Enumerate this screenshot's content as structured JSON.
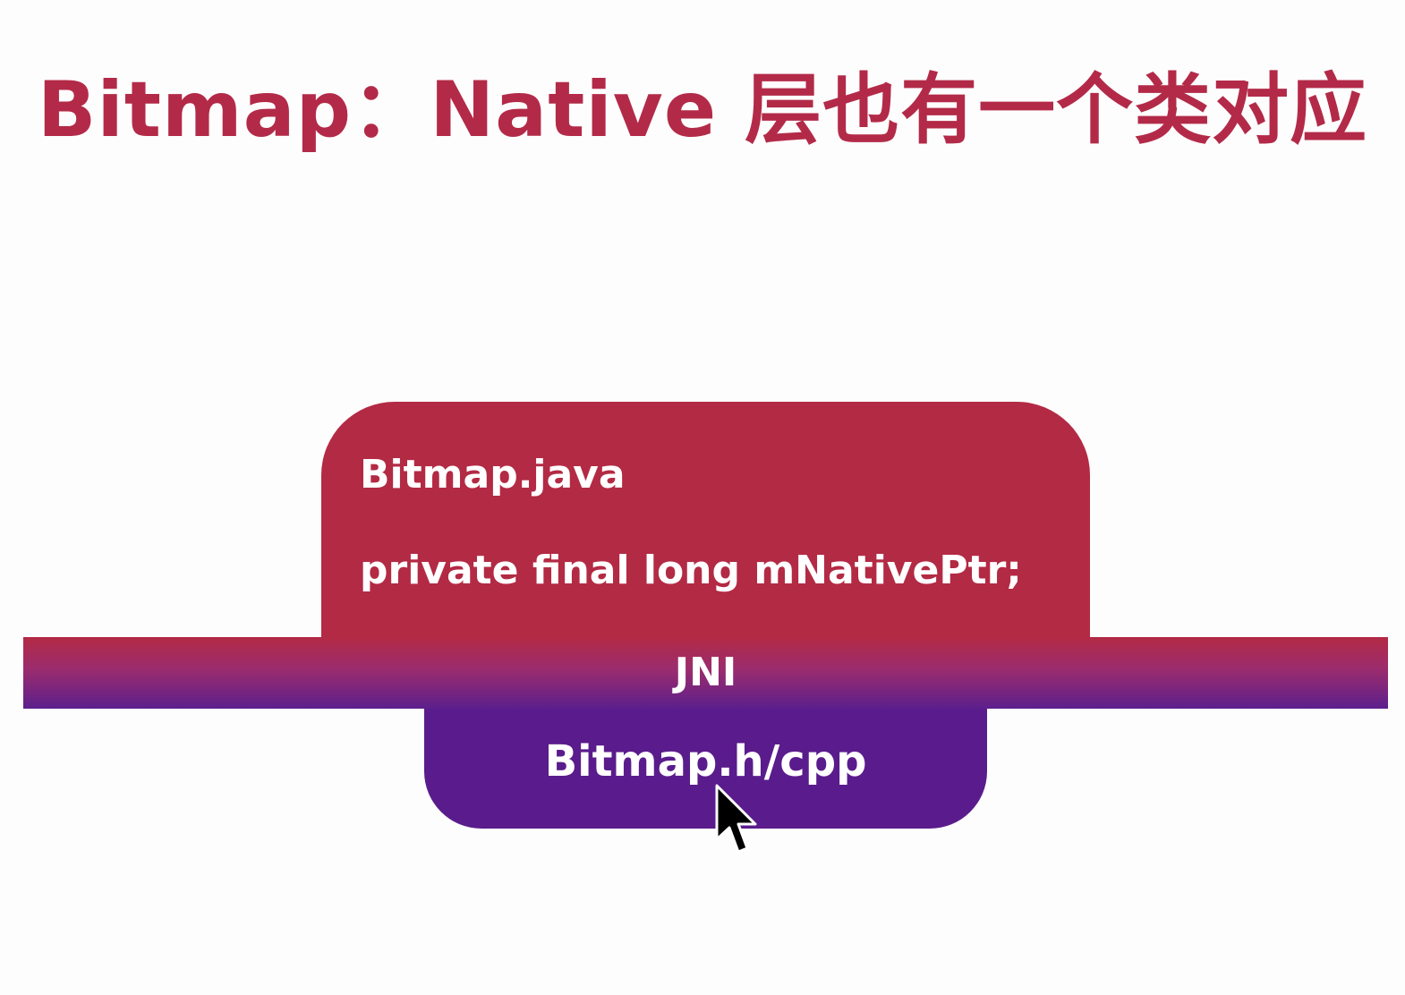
{
  "slide": {
    "title": "Bitmap：Native 层也有一个类对应"
  },
  "diagram": {
    "java_layer": {
      "file": "Bitmap.java",
      "field": "private final long mNativePtr;"
    },
    "bridge": {
      "label": "JNI"
    },
    "native_layer": {
      "file": "Bitmap.h/cpp"
    }
  },
  "colors": {
    "title": "#b32a48",
    "java_box": "#b32a44",
    "native_box": "#5a1c8c",
    "text": "#ffffff"
  },
  "icons": {
    "pointer": "mouse-pointer-icon"
  }
}
